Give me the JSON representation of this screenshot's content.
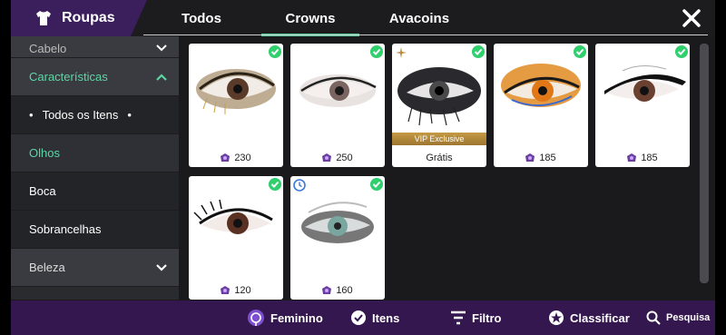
{
  "header": {
    "title": "Roupas",
    "tabs": [
      {
        "label": "Todos"
      },
      {
        "label": "Crowns"
      },
      {
        "label": "Avacoins"
      }
    ],
    "active_tab": "Crowns"
  },
  "sidebar": {
    "items": [
      {
        "label": "Cabelo"
      },
      {
        "label": "Características"
      },
      {
        "label": "Todos os Itens"
      },
      {
        "label": "Olhos"
      },
      {
        "label": "Boca"
      },
      {
        "label": "Sobrancelhas"
      },
      {
        "label": "Beleza"
      }
    ]
  },
  "items": [
    {
      "price": "230",
      "owned": true
    },
    {
      "price": "250",
      "owned": true
    },
    {
      "price": "Grátis",
      "owned": true,
      "vip": "VIP Exclusive"
    },
    {
      "price": "185",
      "owned": true
    },
    {
      "price": "185",
      "owned": true
    },
    {
      "price": "120",
      "owned": true
    },
    {
      "price": "160",
      "owned": true,
      "limited": true
    }
  ],
  "bottombar": {
    "feminino": "Feminino",
    "itens": "Itens",
    "filtro": "Filtro",
    "classificar": "Classificar",
    "pesquisa": "Pesquisa"
  },
  "colors": {
    "accent_green": "#5dd6a6",
    "purple_dark": "#35174f",
    "purple_title": "#3b1e5c",
    "check_green": "#2fcf6e",
    "vip_gold": "#b98a3c"
  }
}
